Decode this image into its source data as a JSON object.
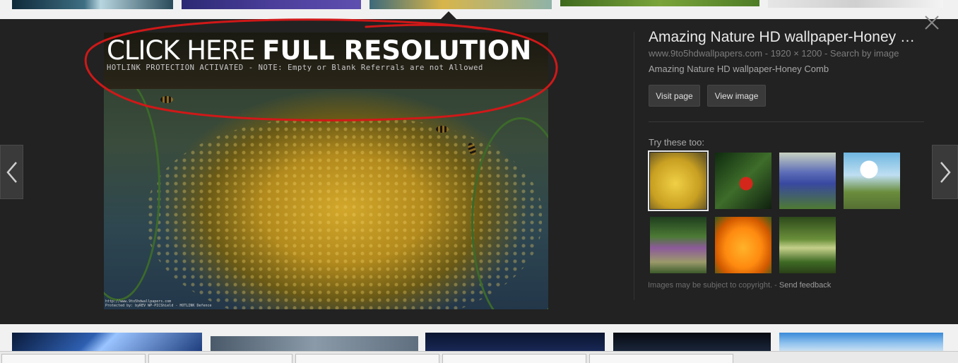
{
  "overlay": {
    "title_thin": "CLICK HERE ",
    "title_bold": "FULL RESOLUTION",
    "note": "HOTLINK PROTECTION ACTIVATED - NOTE: Empty or Blank Referrals are not Allowed",
    "site_line1": "http://www.9to5hdwallpapers.com",
    "site_line2": "Protected by: byREV WP-PICShield - HOTLINK Defence"
  },
  "info": {
    "title": "Amazing Nature HD wallpaper-Honey …",
    "source": "www.9to5hdwallpapers.com - 1920 × 1200 - Search by image",
    "description": "Amazing Nature HD wallpaper-Honey Comb",
    "visit_page_label": "Visit page",
    "view_image_label": "View image",
    "try_these_label": "Try these too:",
    "copyright": "Images may be subject to copyright. - ",
    "feedback": "Send feedback"
  },
  "icons": {
    "prev": "chevron-left-icon",
    "next": "chevron-right-icon",
    "close": "close-icon"
  },
  "colors": {
    "panel_bg": "#222222",
    "annotation": "#d01818"
  }
}
